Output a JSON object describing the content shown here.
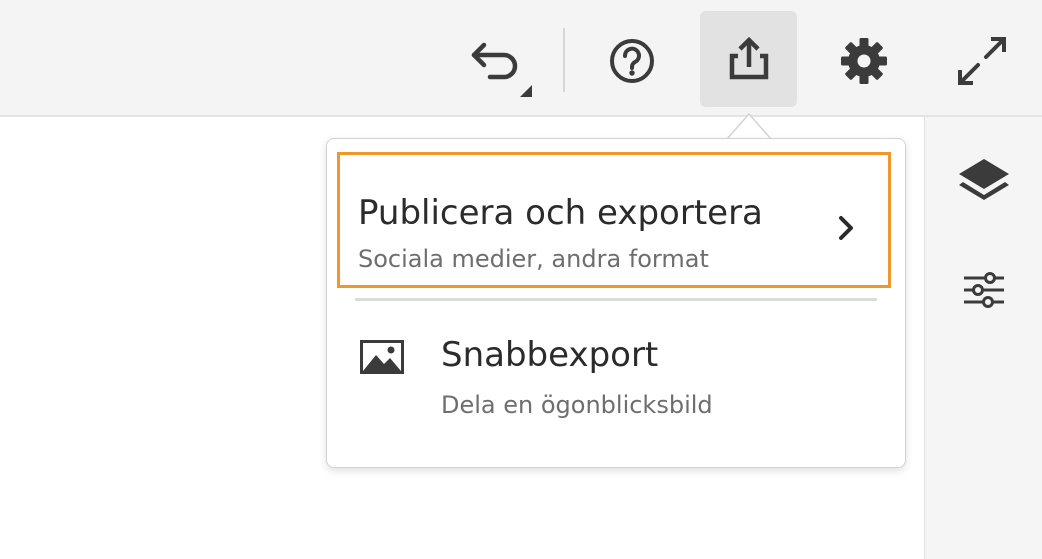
{
  "toolbar": {
    "icons": [
      "undo-icon",
      "help-icon",
      "share-icon",
      "gear-icon",
      "expand-icon"
    ],
    "active": "share-icon"
  },
  "right_rail": {
    "icons": [
      "layers-icon",
      "sliders-icon"
    ]
  },
  "share_menu": {
    "items": [
      {
        "title": "Publicera och exportera",
        "subtitle": "Sociala medier, andra format",
        "icon": "chevron-right-icon"
      },
      {
        "title": "Snabbexport",
        "subtitle": "Dela en ögonblicksbild",
        "icon": "image-icon"
      }
    ]
  },
  "colors": {
    "highlight": "#f0972c",
    "toolbar_bg": "#f4f4f4",
    "active_button_bg": "#e2e2e2",
    "icon": "#3b3b3b"
  }
}
